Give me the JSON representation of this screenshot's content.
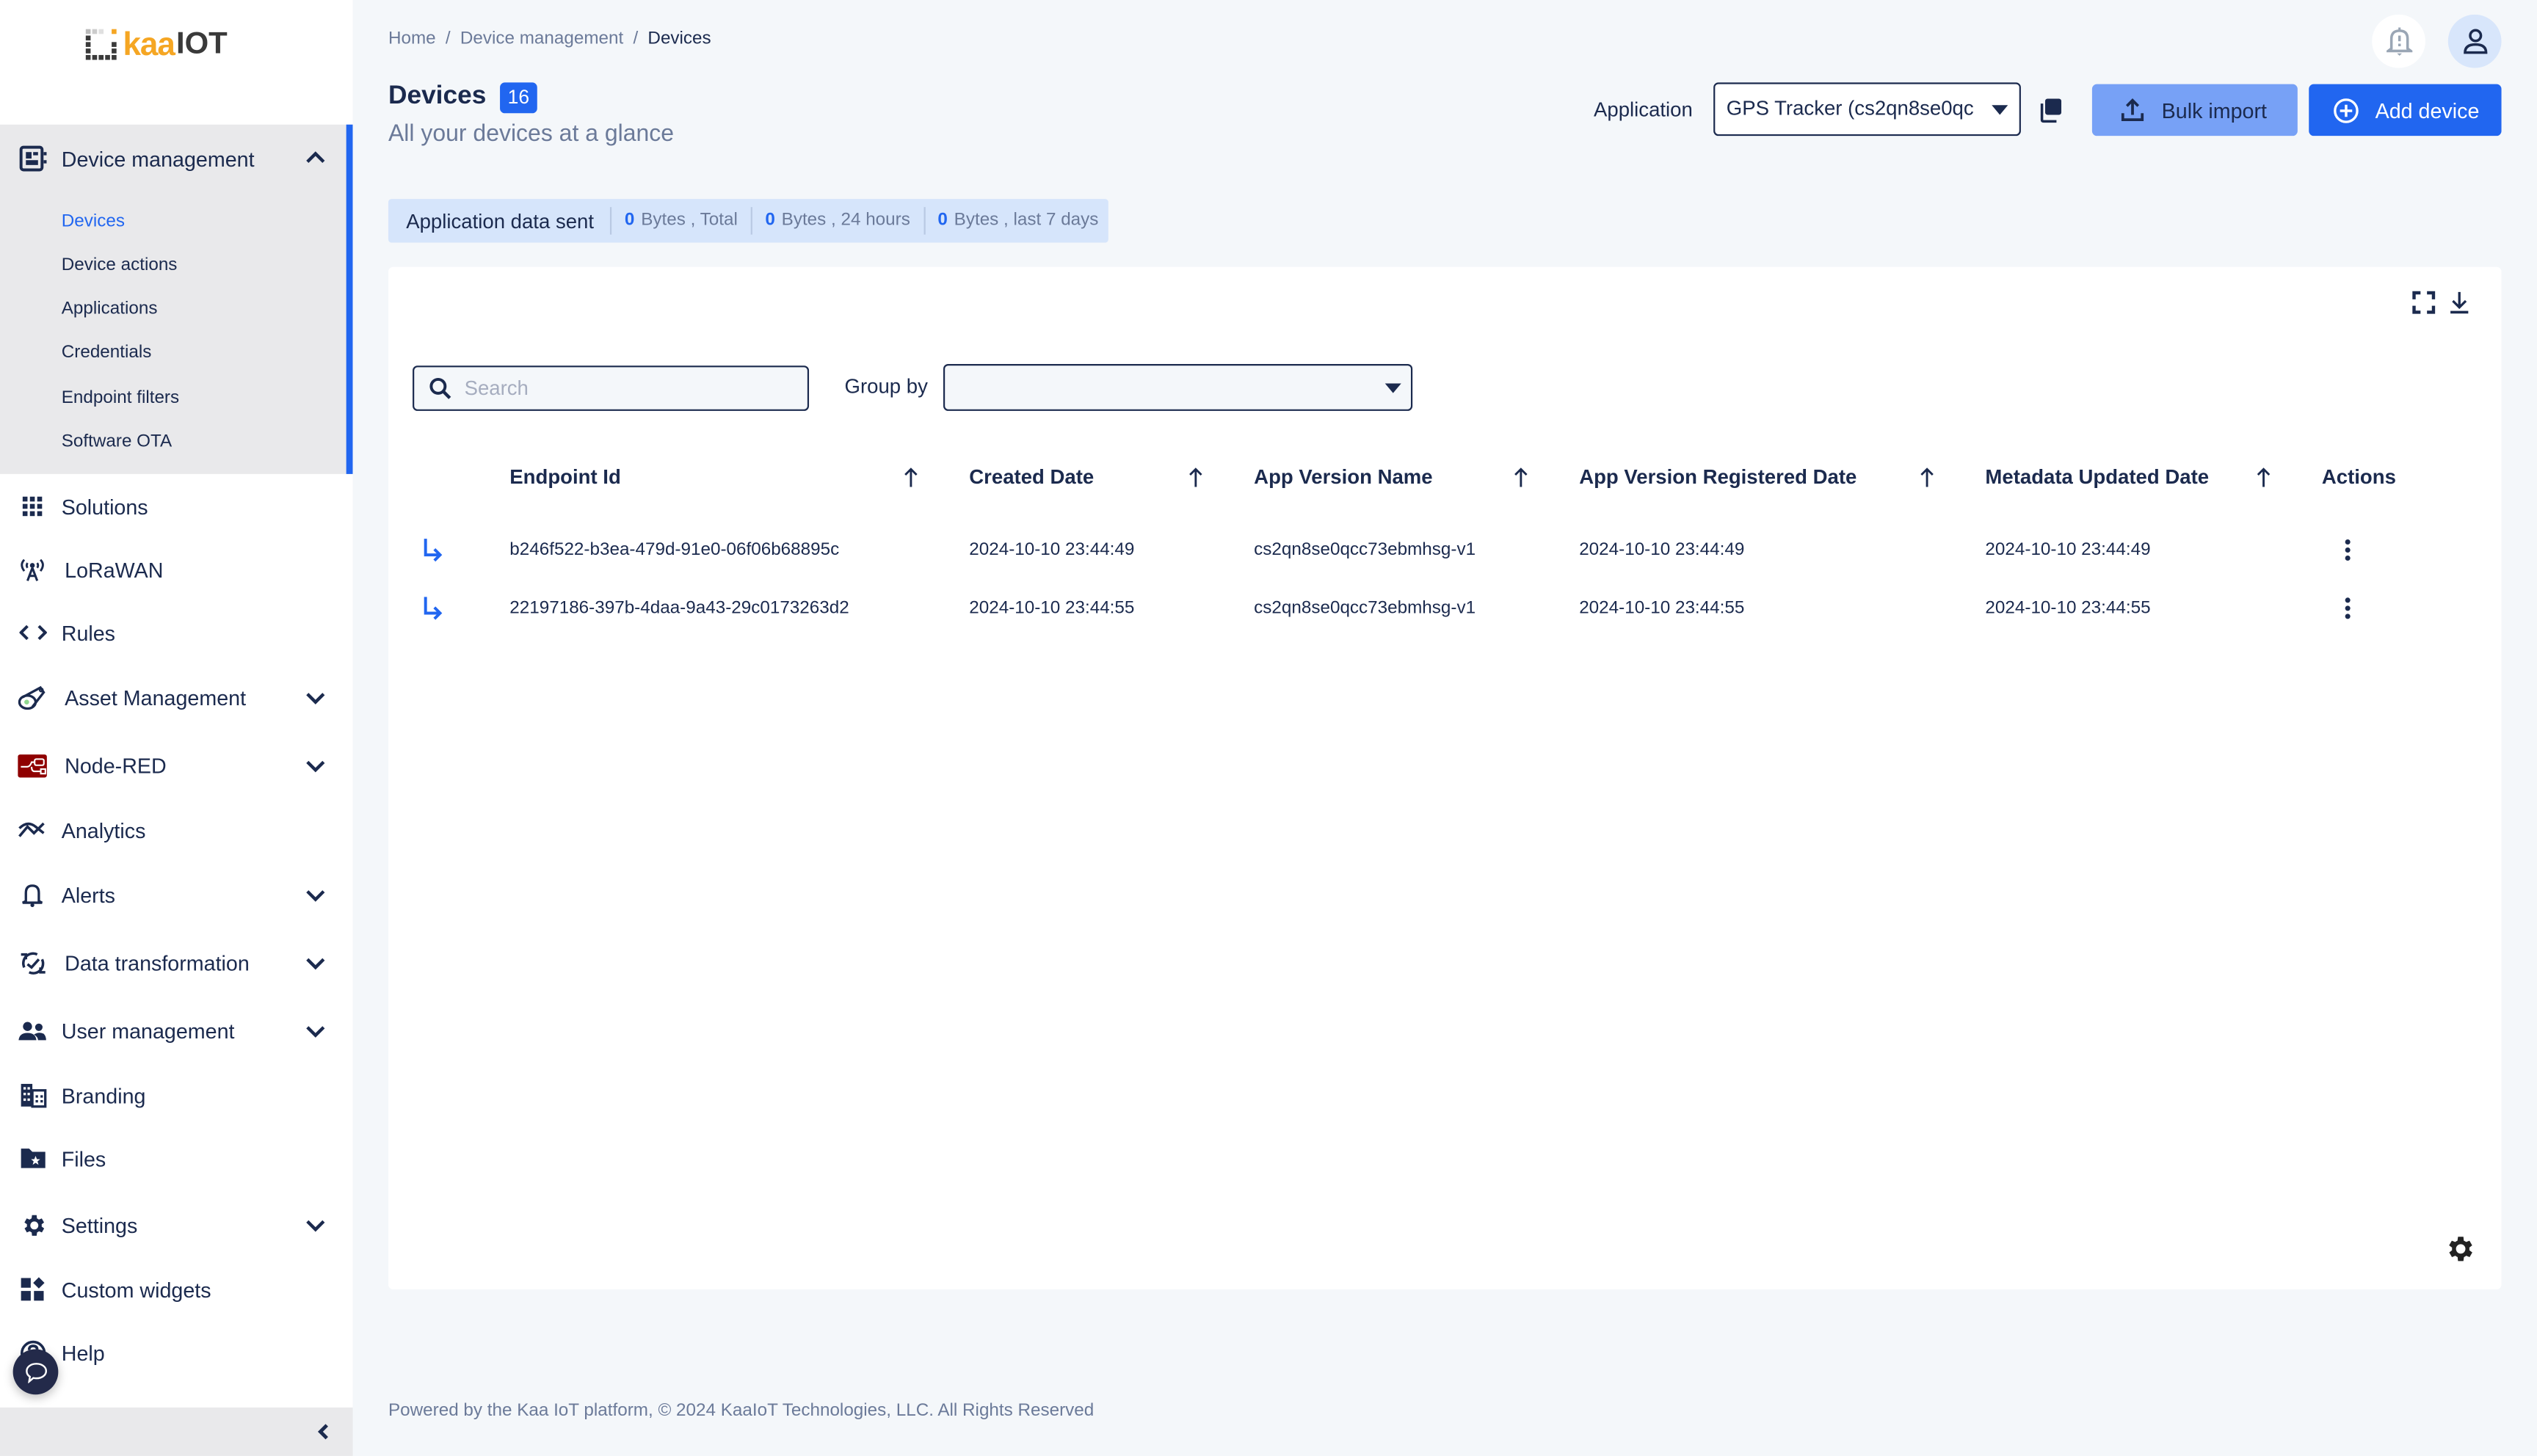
{
  "brand": {
    "logo_part1": "kaa",
    "logo_part2": "IOT",
    "accent": "#2166f0",
    "logo_orange": "#f5a623"
  },
  "sidebar": {
    "group": {
      "label": "Device management",
      "expanded": true,
      "icon": "device-chip-icon",
      "items": [
        {
          "label": "Devices",
          "active": true
        },
        {
          "label": "Device actions"
        },
        {
          "label": "Applications"
        },
        {
          "label": "Credentials"
        },
        {
          "label": "Endpoint filters"
        },
        {
          "label": "Software OTA"
        }
      ]
    },
    "items": [
      {
        "label": "Solutions",
        "icon": "grid-icon",
        "expandable": false
      },
      {
        "label": "LoRaWAN",
        "icon": "antenna-icon",
        "expandable": false
      },
      {
        "label": "Rules",
        "icon": "code-icon",
        "expandable": false
      },
      {
        "label": "Asset Management",
        "icon": "asset-tag-icon",
        "expandable": true
      },
      {
        "label": "Node-RED",
        "icon": "node-red-icon",
        "expandable": true
      },
      {
        "label": "Analytics",
        "icon": "analytics-icon",
        "expandable": false
      },
      {
        "label": "Alerts",
        "icon": "bell-icon",
        "expandable": true
      },
      {
        "label": "Data transformation",
        "icon": "transform-icon",
        "expandable": true
      },
      {
        "label": "User management",
        "icon": "users-icon",
        "expandable": true
      },
      {
        "label": "Branding",
        "icon": "building-icon",
        "expandable": false
      },
      {
        "label": "Files",
        "icon": "folder-star-icon",
        "expandable": false
      },
      {
        "label": "Settings",
        "icon": "gear-icon",
        "expandable": true
      },
      {
        "label": "Custom widgets",
        "icon": "widgets-icon",
        "expandable": false
      },
      {
        "label": "Help",
        "icon": "help-icon",
        "expandable": false
      }
    ]
  },
  "breadcrumb": [
    "Home",
    "Device management",
    "Devices"
  ],
  "header": {
    "title": "Devices",
    "count": "16",
    "subtitle": "All your devices at a glance",
    "application_label": "Application",
    "application_value": "GPS Tracker (cs2qn8se0qc",
    "bulk_import_label": "Bulk import",
    "add_device_label": "Add device"
  },
  "data_sent": {
    "title": "Application data sent",
    "segments": [
      {
        "value": "0",
        "unit": "Bytes , Total"
      },
      {
        "value": "0",
        "unit": "Bytes , 24 hours"
      },
      {
        "value": "0",
        "unit": "Bytes , last 7 days"
      }
    ]
  },
  "table": {
    "search_placeholder": "Search",
    "search_value": "",
    "group_by_label": "Group by",
    "group_by_value": "",
    "columns": [
      "Endpoint Id",
      "Created Date",
      "App Version Name",
      "App Version Registered Date",
      "Metadata Updated Date",
      "Actions"
    ],
    "rows": [
      {
        "endpoint_id": "b246f522-b3ea-479d-91e0-06f06b68895c",
        "created": "2024-10-10 23:44:49",
        "app_version": "cs2qn8se0qcc73ebmhsg-v1",
        "registered": "2024-10-10 23:44:49",
        "metadata_updated": "2024-10-10 23:44:49"
      },
      {
        "endpoint_id": "22197186-397b-4daa-9a43-29c0173263d2",
        "created": "2024-10-10 23:44:55",
        "app_version": "cs2qn8se0qcc73ebmhsg-v1",
        "registered": "2024-10-10 23:44:55",
        "metadata_updated": "2024-10-10 23:44:55"
      }
    ]
  },
  "footer": "Powered by the Kaa IoT platform, © 2024 KaaIoT Technologies, LLC. All Rights Reserved"
}
